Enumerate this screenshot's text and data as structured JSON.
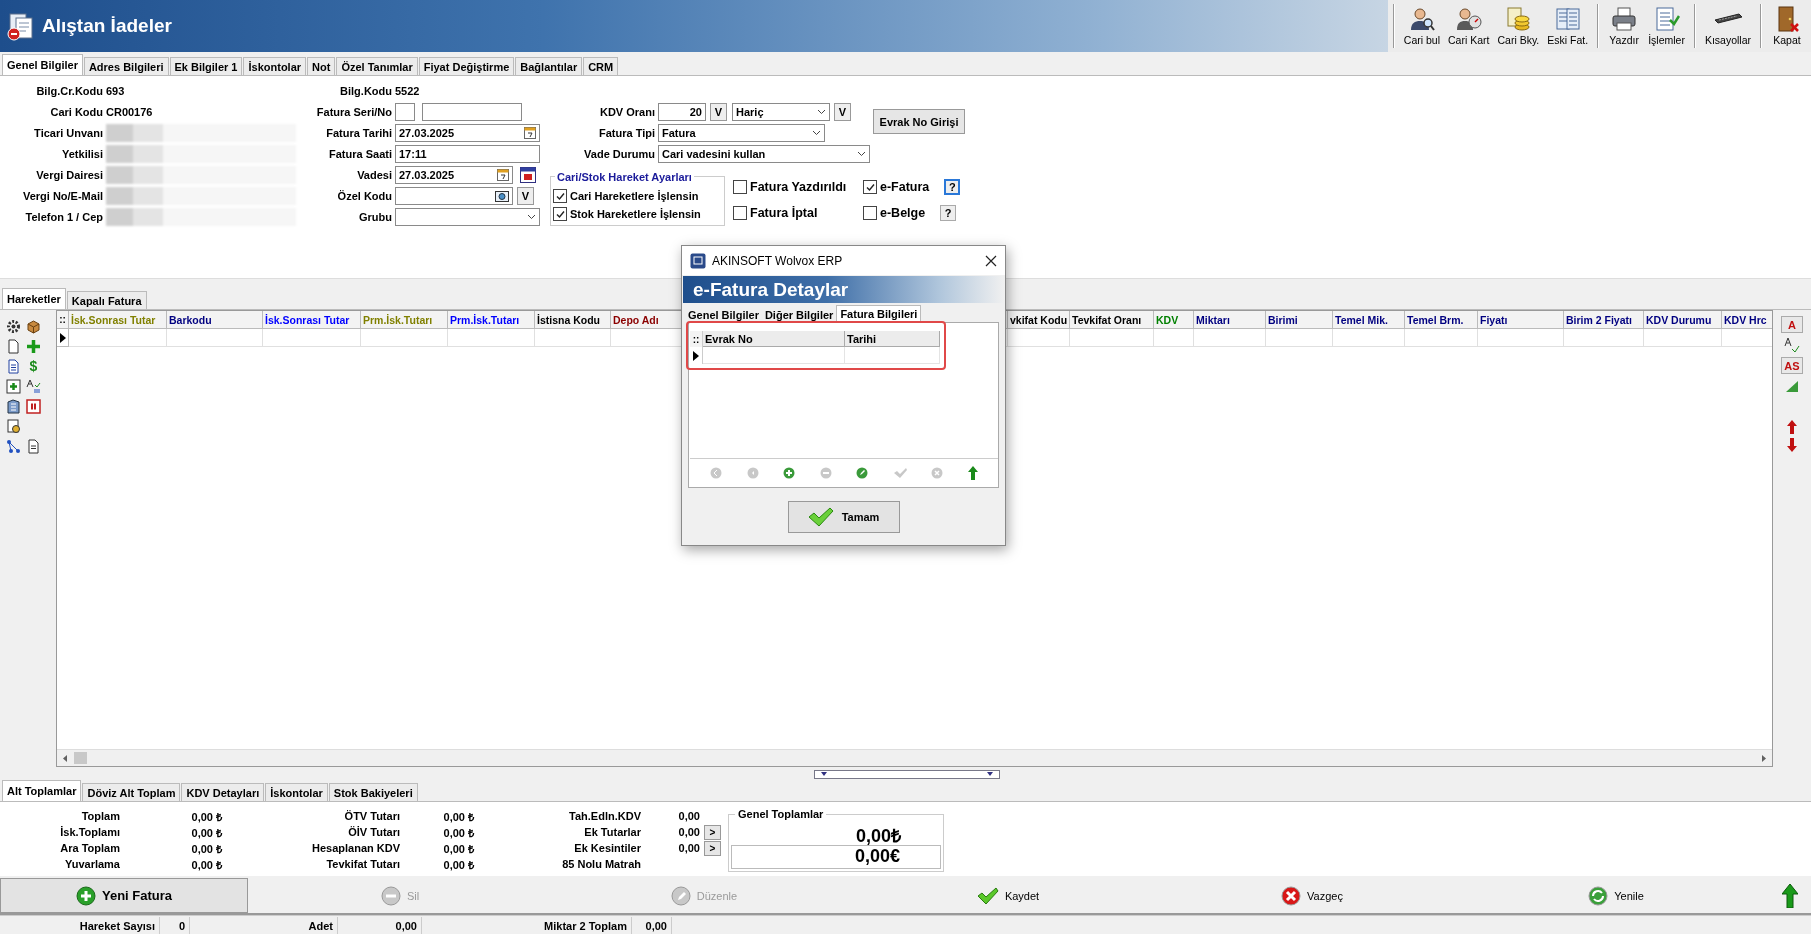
{
  "window": {
    "title": "Alıştan İadeler"
  },
  "toolbar": [
    [
      {
        "label": "Cari bul"
      },
      {
        "label": "Cari Kart"
      },
      {
        "label": "Cari Bky."
      },
      {
        "label": "Eski Fat."
      }
    ],
    [
      {
        "label": "Yazdır"
      },
      {
        "label": "İşlemler"
      }
    ],
    [
      {
        "label": "Kısayollar"
      }
    ],
    [
      {
        "label": "Kapat"
      }
    ]
  ],
  "tabs": [
    {
      "label": "Genel Bilgiler",
      "selected": true
    },
    {
      "label": "Adres Bilgileri",
      "selected": false
    },
    {
      "label": "Ek Bilgiler 1",
      "selected": false
    },
    {
      "label": "İskontolar",
      "selected": false
    },
    {
      "label": "Not",
      "selected": false
    },
    {
      "label": "Özel Tanımlar",
      "selected": false
    },
    {
      "label": "Fiyat Değiştirme",
      "selected": false
    },
    {
      "label": "Bağlantılar",
      "selected": false
    },
    {
      "label": "CRM",
      "selected": false
    }
  ],
  "customer": [
    {
      "label": "Bilg.Cr.Kodu",
      "value": "693",
      "kind": "text"
    },
    {
      "label": "Cari Kodu",
      "value": "CR00176",
      "kind": "text"
    },
    {
      "label": "Ticari Unvanı",
      "kind": "redacted"
    },
    {
      "label": "Yetkilisi",
      "kind": "redacted"
    },
    {
      "label": "Vergi Dairesi",
      "kind": "redacted"
    },
    {
      "label": "Vergi No/E-Mail",
      "kind": "redacted"
    },
    {
      "label": "Telefon 1 / Cep",
      "kind": "redacted"
    }
  ],
  "invoice": {
    "record": {
      "label": "Bilg.Kodu",
      "value": "5522"
    },
    "rows": [
      {
        "label": "Fatura Seri/No",
        "kind": "pair"
      },
      {
        "label": "Fatura Tarihi",
        "value": "27.03.2025",
        "kind": "date"
      },
      {
        "label": "Fatura Saati",
        "value": "17:11",
        "kind": "text"
      },
      {
        "label": "Vadesi",
        "value": "27.03.2025",
        "kind": "due"
      },
      {
        "label": "Özel Kodu",
        "kind": "code",
        "button": "V"
      },
      {
        "label": "Grubu",
        "kind": "combo"
      }
    ]
  },
  "kdv": {
    "label": "KDV Oranı",
    "value": "20",
    "button": "V",
    "mode": "Hariç",
    "mode_button": "V"
  },
  "evrak_button": "Evrak No Girişi",
  "fatura_tipi": {
    "label": "Fatura Tipi",
    "value": "Fatura"
  },
  "vade_durumu": {
    "label": "Vade Durumu",
    "value": "Cari vadesini kullan"
  },
  "movement_settings": {
    "title": "Cari/Stok Hareket Ayarları",
    "options": [
      {
        "label": "Cari Hareketlere İşlensin",
        "checked": true
      },
      {
        "label": "Stok Hareketlere İşlensin",
        "checked": true
      }
    ]
  },
  "flags": [
    {
      "label": "Fatura Yazdırıldı",
      "checked": false
    },
    {
      "label": "e-Fatura",
      "checked": true,
      "help": "?",
      "focused": true
    },
    {
      "label": "Fatura İptal",
      "checked": false
    },
    {
      "label": "e-Belge",
      "checked": false,
      "help": "?",
      "focused": false
    }
  ],
  "grid_tabs": [
    {
      "label": "Hareketler",
      "selected": true
    },
    {
      "label": "Kapalı Fatura",
      "selected": false
    }
  ],
  "grid": {
    "corner": "::",
    "columns": [
      {
        "label": "İsk.Sonrası Tutar",
        "color": "#808000"
      },
      {
        "label": "Barkodu",
        "color": "#000080"
      },
      {
        "label": "İsk.Sonrası Tutar",
        "color": "#0000ff"
      },
      {
        "label": "Prm.İsk.Tutarı",
        "color": "#808000"
      },
      {
        "label": "Prm.İsk.Tutarı",
        "color": "#0000ff"
      },
      {
        "label": "İstisna Kodu",
        "color": "#000000"
      },
      {
        "label": "Depo Adı",
        "color": "#8b0000"
      },
      {
        "label": "vkifat Kodu",
        "color": "#000000"
      },
      {
        "label": "Tevkifat Oranı",
        "color": "#000000"
      },
      {
        "label": "KDV",
        "color": "#008000"
      },
      {
        "label": "Miktarı",
        "color": "#000080"
      },
      {
        "label": "Birimi",
        "color": "#000080"
      },
      {
        "label": "Temel Mik.",
        "color": "#000080"
      },
      {
        "label": "Temel Brm.",
        "color": "#000080"
      },
      {
        "label": "Fiyatı",
        "color": "#000080"
      },
      {
        "label": "Birim 2 Fiyatı",
        "color": "#000080"
      },
      {
        "label": "KDV Durumu",
        "color": "#000080"
      },
      {
        "label": "KDV Hrc",
        "color": "#000080"
      }
    ]
  },
  "grid_tools": {
    "currency": "$"
  },
  "side_buttons": [
    "A",
    "AS"
  ],
  "dialog": {
    "title": "AKINSOFT Wolvox ERP",
    "banner": "e-Fatura Detaylar",
    "tabs": [
      {
        "label": "Genel Bilgiler",
        "selected": false
      },
      {
        "label": "Diğer Bilgiler",
        "selected": false
      },
      {
        "label": "Fatura Bilgileri",
        "selected": true
      }
    ],
    "corner": "::",
    "columns": [
      "Evrak No",
      "Tarihi"
    ],
    "ok_button": "Tamam"
  },
  "bottom_tabs": [
    {
      "label": "Alt Toplamlar",
      "selected": true
    },
    {
      "label": "Döviz Alt Toplam",
      "selected": false
    },
    {
      "label": "KDV Detayları",
      "selected": false
    },
    {
      "label": "İskontolar",
      "selected": false
    },
    {
      "label": "Stok Bakiyeleri",
      "selected": false
    }
  ],
  "totals": [
    [
      {
        "label": "Toplam",
        "value": "0,00 ₺"
      },
      {
        "label": "İsk.Toplamı",
        "value": "0,00 ₺"
      },
      {
        "label": "Ara Toplam",
        "value": "0,00 ₺"
      },
      {
        "label": "Yuvarlama",
        "value": "0,00 ₺"
      }
    ],
    [
      {
        "label": "ÖTV Tutarı",
        "value": "0,00 ₺"
      },
      {
        "label": "ÖİV Tutarı",
        "value": "0,00 ₺"
      },
      {
        "label": "Hesaplanan KDV",
        "value": "0,00 ₺"
      },
      {
        "label": "Tevkifat Tutarı",
        "value": "0,00 ₺"
      }
    ],
    [
      {
        "label": "Tah.Edln.KDV",
        "value": "0,00"
      },
      {
        "label": "Ek Tutarlar",
        "value": "0,00",
        "more": ">"
      },
      {
        "label": "Ek Kesintiler",
        "value": "0,00",
        "more": ">"
      },
      {
        "label": "85 Nolu Matrah"
      }
    ]
  ],
  "grand_totals": {
    "title": "Genel Toplamlar",
    "values": [
      "0,00₺",
      "0,00€"
    ]
  },
  "actions": [
    {
      "label": "Yeni Fatura",
      "kind": "new",
      "disabled": false
    },
    {
      "label": "Sil",
      "kind": "delete",
      "disabled": true
    },
    {
      "label": "Düzenle",
      "kind": "edit",
      "disabled": true
    },
    {
      "label": "Kaydet",
      "kind": "save",
      "disabled": false
    },
    {
      "label": "Vazgeç",
      "kind": "cancel",
      "disabled": false
    },
    {
      "label": "Yenile",
      "kind": "refresh",
      "disabled": false
    }
  ],
  "status_bar": [
    {
      "label": "Hareket Sayısı",
      "value": "0"
    },
    {
      "label": "Adet",
      "value": "0,00"
    },
    {
      "label": "Miktar 2 Toplam",
      "value": "0,00"
    }
  ]
}
